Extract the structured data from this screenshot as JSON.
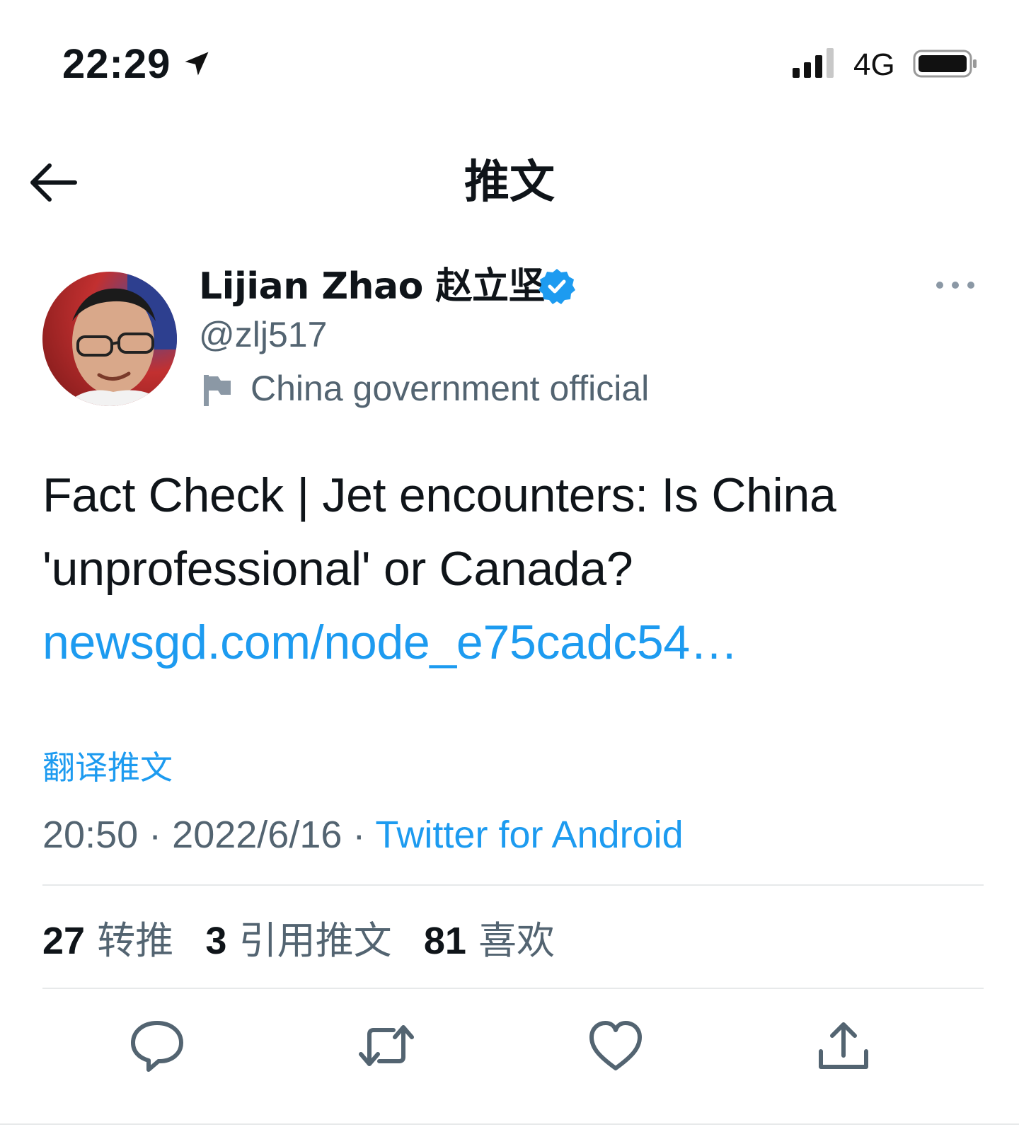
{
  "status_bar": {
    "time": "22:29",
    "network": "4G"
  },
  "header": {
    "title": "推文"
  },
  "tweet": {
    "author_name": "Lijian Zhao 赵立坚",
    "handle": "@zlj517",
    "label": "China government official",
    "text_line1": "Fact Check | Jet encounters: Is China",
    "text_line2": "'unprofessional' or Canada?",
    "link": "newsgd.com/node_e75cadc54…",
    "translate": "翻译推文",
    "time": "20:50",
    "date": "2022/6/16",
    "separator": "·",
    "source": "Twitter for Android"
  },
  "stats": {
    "retweets_count": "27",
    "retweets_label": "转推",
    "quotes_count": "3",
    "quotes_label": "引用推文",
    "likes_count": "81",
    "likes_label": "喜欢"
  },
  "colors": {
    "accent": "#1d9bf0",
    "secondary_text": "#536471",
    "primary_text": "#0f1419",
    "divider": "#e7e9ea"
  },
  "icons": {
    "location": "location-arrow-icon",
    "signal": "signal-bars-icon",
    "battery": "battery-icon",
    "back": "arrow-left-icon",
    "verified": "verified-badge-icon",
    "more": "more-horizontal-icon",
    "flag": "flag-icon",
    "reply": "reply-bubble-icon",
    "retweet": "retweet-icon",
    "like": "heart-icon",
    "share": "share-icon"
  }
}
